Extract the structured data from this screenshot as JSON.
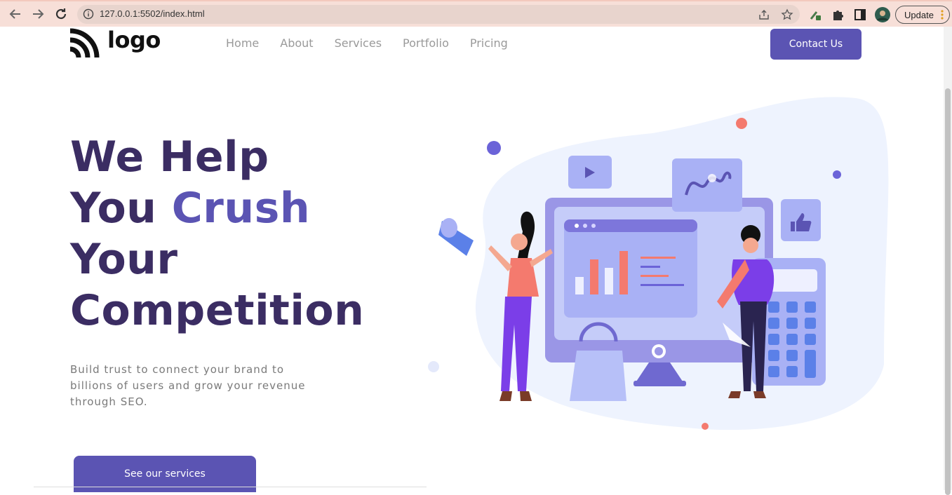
{
  "browser": {
    "url": "127.0.0.1:5502/index.html",
    "update_label": "Update"
  },
  "header": {
    "logo_text": "logo",
    "nav": [
      "Home",
      "About",
      "Services",
      "Portfolio",
      "Pricing"
    ],
    "contact_label": "Contact Us"
  },
  "hero": {
    "title_line1": "We Help",
    "title_line2_a": "You",
    "title_line2_b": "Crush",
    "title_line3": "Your",
    "title_line4": "Competition",
    "subtitle": "Build trust to connect your brand to billions of users and grow your revenue through SEO.",
    "cta_label": "See our services"
  },
  "colors": {
    "primary": "#5b54b3",
    "heading": "#3b2d63",
    "coral": "#f47a6e",
    "light_blob": "#eef3fe"
  },
  "icons": [
    "back-arrow-icon",
    "forward-arrow-icon",
    "reload-icon",
    "info-icon",
    "share-icon",
    "star-icon",
    "extension-icon",
    "puzzle-icon",
    "sidepanel-icon",
    "profile-avatar"
  ]
}
